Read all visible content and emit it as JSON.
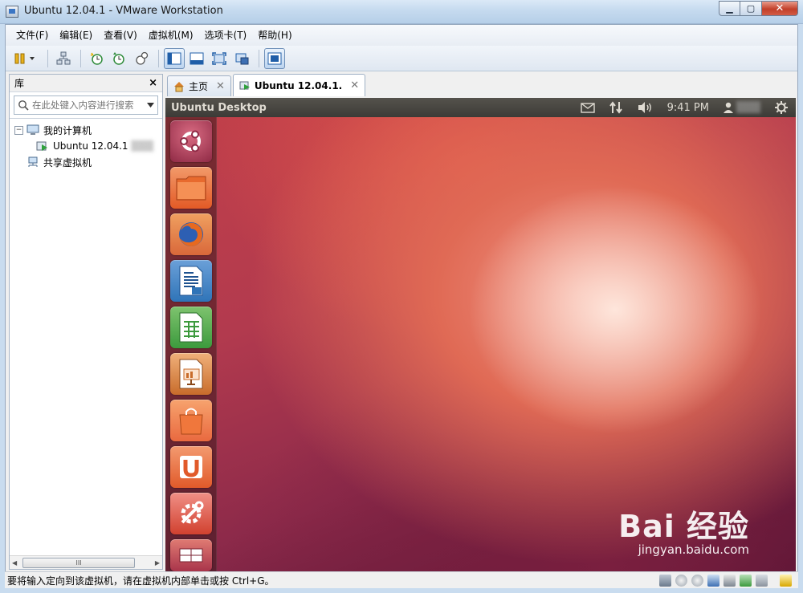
{
  "window": {
    "title": "Ubuntu 12.04.1 - VMware Workstation",
    "min_glyph": "▁",
    "max_glyph": "▢",
    "close_glyph": "✕"
  },
  "menu": [
    "文件(F)",
    "编辑(E)",
    "查看(V)",
    "虚拟机(M)",
    "选项卡(T)",
    "帮助(H)"
  ],
  "library": {
    "title": "库",
    "close_glyph": "×",
    "search_placeholder": "在此处键入内容进行搜索",
    "tree": {
      "my_computer": "我的计算机",
      "vm_item": "Ubuntu 12.04.1",
      "shared": "共享虚拟机"
    },
    "scroll_thumb": "III"
  },
  "tabs": {
    "home": "主页",
    "vm": "Ubuntu 12.04.1."
  },
  "vm": {
    "panel_title": "Ubuntu Desktop",
    "time": "9:41 PM",
    "launcher_icons": [
      "ubuntu-logo",
      "files",
      "firefox",
      "libreoffice-writer",
      "libreoffice-calc",
      "libreoffice-impress",
      "software-center",
      "ubuntu-one",
      "system-settings",
      "workspace-switcher"
    ]
  },
  "watermark": {
    "brand": "Bai 经验",
    "url": "jingyan.baidu.com"
  },
  "status": {
    "text": "要将输入定向到该虚拟机，请在虚拟机内部单击或按 Ctrl+G。"
  },
  "colors": {
    "accent": "#3b76c4",
    "launcher_orange": "#e9693f",
    "firefox": "#e0592a",
    "writer": "#2f74b8",
    "calc": "#3c9a3d",
    "impress": "#c86c2b"
  }
}
